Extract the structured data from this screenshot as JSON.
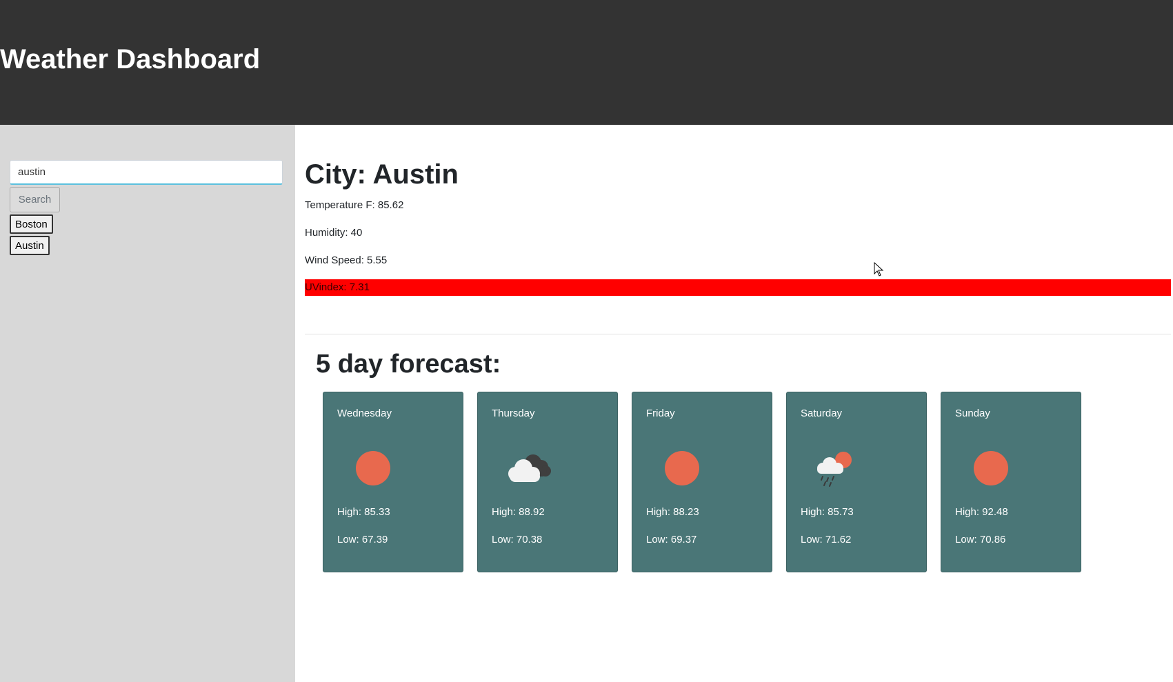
{
  "header": {
    "title": "Weather Dashboard"
  },
  "sidebar": {
    "search_value": "austin",
    "search_label": "Search",
    "history": [
      {
        "label": "Boston"
      },
      {
        "label": "Austin"
      }
    ]
  },
  "current": {
    "city": "City: Austin",
    "temperature": "Temperature F: 85.62",
    "humidity": "Humidity: 40",
    "wind": "Wind Speed: 5.55",
    "uv": "UVindex: 7.31",
    "uv_color": "#ff0000"
  },
  "forecast": {
    "title": "5 day forecast:",
    "days": [
      {
        "day": "Wednesday",
        "icon": "sun-icon",
        "high": "High: 85.33",
        "low": "Low: 67.39"
      },
      {
        "day": "Thursday",
        "icon": "cloudy-icon",
        "high": "High: 88.92",
        "low": "Low: 70.38"
      },
      {
        "day": "Friday",
        "icon": "sun-icon",
        "high": "High: 88.23",
        "low": "Low: 69.37"
      },
      {
        "day": "Saturday",
        "icon": "rain-sun-icon",
        "high": "High: 85.73",
        "low": "Low: 71.62"
      },
      {
        "day": "Sunday",
        "icon": "sun-icon",
        "high": "High: 92.48",
        "low": "Low: 70.86"
      }
    ]
  },
  "colors": {
    "header_bg": "#333333",
    "sidebar_bg": "#d8d8d8",
    "card_bg": "#4a7677",
    "sun": "#e8694e"
  }
}
